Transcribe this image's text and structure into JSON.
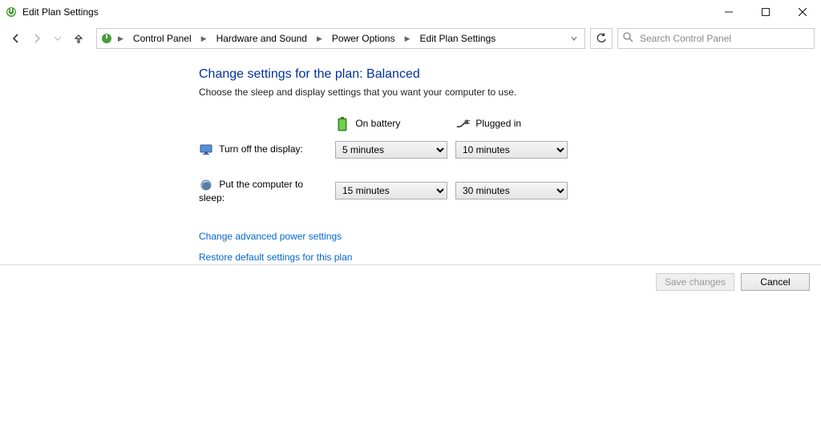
{
  "window": {
    "title": "Edit Plan Settings"
  },
  "breadcrumb": {
    "items": [
      "Control Panel",
      "Hardware and Sound",
      "Power Options",
      "Edit Plan Settings"
    ]
  },
  "search": {
    "placeholder": "Search Control Panel"
  },
  "main": {
    "heading": "Change settings for the plan: Balanced",
    "description": "Choose the sleep and display settings that you want your computer to use.",
    "columns": {
      "battery": "On battery",
      "plugged": "Plugged in"
    },
    "rows": {
      "display": {
        "label": "Turn off the display:",
        "battery_value": "5 minutes",
        "plugged_value": "10 minutes"
      },
      "sleep": {
        "label": "Put the computer to sleep:",
        "battery_value": "15 minutes",
        "plugged_value": "30 minutes"
      }
    },
    "links": {
      "advanced": "Change advanced power settings",
      "restore": "Restore default settings for this plan"
    }
  },
  "footer": {
    "save": "Save changes",
    "cancel": "Cancel"
  }
}
